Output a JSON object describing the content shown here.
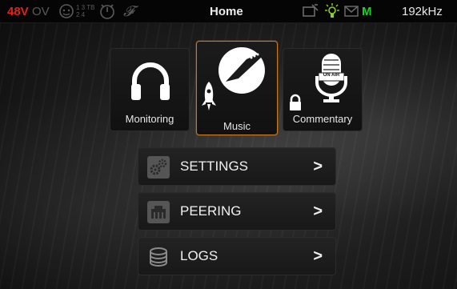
{
  "status_bar": {
    "phantom_power": "48V",
    "overload": "OV",
    "channel_map_icon": "channel-grid-icon",
    "channel_map_numbers": "1 3 TB 2 4",
    "timecode_icon": "dial-icon",
    "function_symbol": "𝓕",
    "title": "Home",
    "battery_icon": "battery-icon",
    "power_indicator_icon": "power-bulb-icon",
    "mail_icon": "mail-icon",
    "mode_letter": "M",
    "sample_rate": "192kHz",
    "colors": {
      "red": "#e0201a",
      "green": "#19d12a",
      "dim": "#5a5a5a"
    }
  },
  "modes": [
    {
      "label": "Monitoring",
      "icon": "headphones-icon",
      "active": false
    },
    {
      "label": "Music",
      "icon": "guitar-icon",
      "badge_icon": "rocket-icon",
      "active": true
    },
    {
      "label": "Commentary",
      "icon": "microphone-icon",
      "badge_icon": "lock-icon",
      "badge_text": "ON AIR",
      "active": false
    }
  ],
  "menu": [
    {
      "label": "SETTINGS",
      "icon": "gears-icon",
      "arrow": ">"
    },
    {
      "label": "PEERING",
      "icon": "network-icon",
      "arrow": ">"
    },
    {
      "label": "LOGS",
      "icon": "database-icon",
      "arrow": ">"
    }
  ],
  "accent_color": "#c8781e"
}
